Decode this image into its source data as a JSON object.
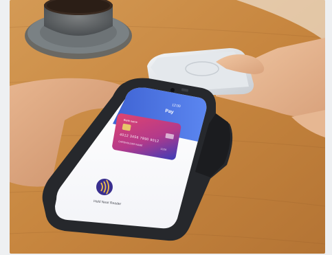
{
  "phone_screen": {
    "status_time": "12:00",
    "header_title": "Pay",
    "card": {
      "brand": "Bank name",
      "number": "4012 3456 7890 9012",
      "holder": "CARDHOLDER NAME",
      "expiry": "12/28"
    },
    "prompt": "Hold Near Reader",
    "contactless_icon": "contactless-icon"
  },
  "colors": {
    "table_wood": "#c7863f",
    "screen_header": "#4f6fd8",
    "card_gradient_start": "#e0446f",
    "card_gradient_end": "#3b3cb8",
    "device_body": "#2a2c30",
    "contactless_icon_bg": "#3a2f8f"
  }
}
